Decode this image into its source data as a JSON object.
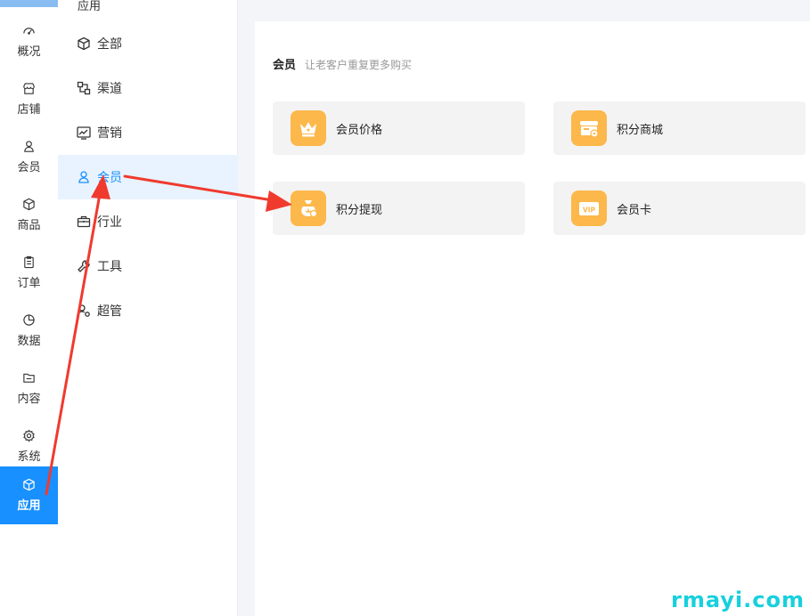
{
  "rail": {
    "items": [
      {
        "label": "概况",
        "icon": "dashboard-icon"
      },
      {
        "label": "店铺",
        "icon": "store-icon"
      },
      {
        "label": "会员",
        "icon": "user-icon"
      },
      {
        "label": "商品",
        "icon": "box-icon"
      },
      {
        "label": "订单",
        "icon": "clipboard-icon"
      },
      {
        "label": "数据",
        "icon": "pie-icon"
      },
      {
        "label": "内容",
        "icon": "folder-icon"
      },
      {
        "label": "系统",
        "icon": "gear-icon"
      },
      {
        "label": "应用",
        "icon": "cube-icon"
      }
    ],
    "active": "应用"
  },
  "subnav": {
    "title": "应用",
    "items": [
      {
        "label": "全部",
        "icon": "cube-icon"
      },
      {
        "label": "渠道",
        "icon": "channel-icon"
      },
      {
        "label": "营销",
        "icon": "chart-icon"
      },
      {
        "label": "会员",
        "icon": "user-icon"
      },
      {
        "label": "行业",
        "icon": "briefcase-icon"
      },
      {
        "label": "工具",
        "icon": "tool-icon"
      },
      {
        "label": "超管",
        "icon": "admin-icon"
      }
    ],
    "active": "会员"
  },
  "main": {
    "section_title": "会员",
    "section_sub": "让老客户重复更多购买",
    "cards": [
      {
        "label": "会员价格",
        "icon": "crown-icon"
      },
      {
        "label": "积分商城",
        "icon": "points-mall-icon"
      },
      {
        "label": "积分提现",
        "icon": "money-bag-icon"
      },
      {
        "label": "会员卡",
        "icon": "vip-card-icon"
      }
    ]
  },
  "colors": {
    "accent": "#1890ff",
    "card_icon": "#fcb84b",
    "arrow": "#f03a2e"
  },
  "watermark": "rmayi.com"
}
